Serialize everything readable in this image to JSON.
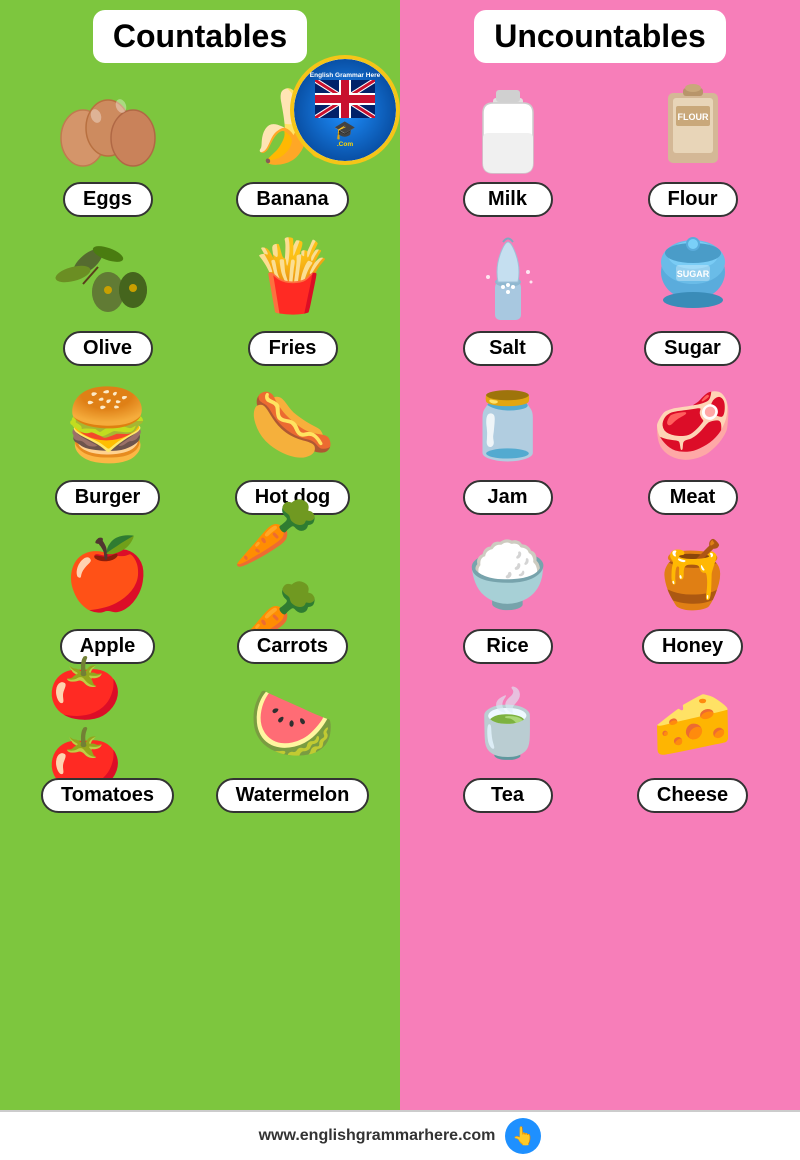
{
  "left": {
    "title": "Countables",
    "items": [
      {
        "label": "Eggs",
        "emoji": "🥚"
      },
      {
        "label": "Banana",
        "emoji": "🍌"
      },
      {
        "label": "Olive",
        "emoji": "🫒"
      },
      {
        "label": "Fries",
        "emoji": "🍟"
      },
      {
        "label": "Burger",
        "emoji": "🍔"
      },
      {
        "label": "Hot dog",
        "emoji": "🌭"
      },
      {
        "label": "Apple",
        "emoji": "🍎"
      },
      {
        "label": "Carrots",
        "emoji": "🥕"
      },
      {
        "label": "Tomatoes",
        "emoji": "🍅"
      },
      {
        "label": "Watermelon",
        "emoji": "🍉"
      }
    ]
  },
  "right": {
    "title": "Uncountables",
    "items": [
      {
        "label": "Milk",
        "emoji": "🥛"
      },
      {
        "label": "Flour",
        "emoji": "🧂"
      },
      {
        "label": "Salt",
        "emoji": "🧂"
      },
      {
        "label": "Sugar",
        "emoji": "🍬"
      },
      {
        "label": "Jam",
        "emoji": "🫙"
      },
      {
        "label": "Meat",
        "emoji": "🥩"
      },
      {
        "label": "Rice",
        "emoji": "🍚"
      },
      {
        "label": "Honey",
        "emoji": "🍯"
      },
      {
        "label": "Tea",
        "emoji": "🍵"
      },
      {
        "label": "Cheese",
        "emoji": "🧀"
      }
    ]
  },
  "footer": {
    "url": "www.englishgrammarhere.com"
  },
  "logo": {
    "text_top": "English Grammar Here",
    "text_bottom": ".Com"
  }
}
